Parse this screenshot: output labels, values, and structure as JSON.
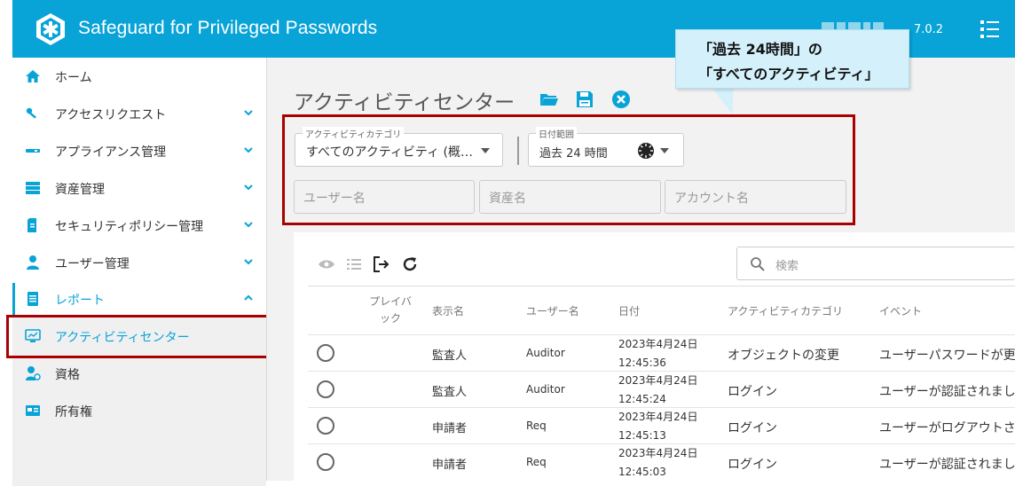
{
  "header": {
    "app_title": "Safeguard for Privileged Passwords",
    "version": "7.0.2"
  },
  "sidebar": {
    "items": [
      {
        "label": "ホーム",
        "icon": "home-icon"
      },
      {
        "label": "アクセスリクエスト",
        "icon": "key-icon"
      },
      {
        "label": "アプライアンス管理",
        "icon": "appliance-icon"
      },
      {
        "label": "資産管理",
        "icon": "server-icon"
      },
      {
        "label": "セキュリティポリシー管理",
        "icon": "policy-icon"
      },
      {
        "label": "ユーザー管理",
        "icon": "user-icon"
      },
      {
        "label": "レポート",
        "icon": "report-icon"
      },
      {
        "label": "アクティビティセンター",
        "icon": "monitor-icon"
      },
      {
        "label": "資格",
        "icon": "entitlement-icon"
      },
      {
        "label": "所有権",
        "icon": "ownership-icon"
      }
    ]
  },
  "page": {
    "title": "アクティビティセンター"
  },
  "filters": {
    "category_legend": "アクティビティカテゴリ",
    "category_value": "すべてのアクティビティ (概…",
    "date_legend": "日付範囲",
    "date_value": "過去 24 時間",
    "user_placeholder": "ユーザー名",
    "asset_placeholder": "資産名",
    "account_placeholder": "アカウント名"
  },
  "callout": {
    "line1": "「過去 24時間」の",
    "line2": "「すべてのアクティビティ」"
  },
  "grid": {
    "search_placeholder": "検索",
    "columns": {
      "playback": "プレイバ\nック",
      "display_name": "表示名",
      "user_name": "ユーザー名",
      "date": "日付",
      "category": "アクティビティカテゴリ",
      "event": "イベント"
    },
    "rows": [
      {
        "display_name": "監査人",
        "user_name": "Auditor",
        "date": "2023年4月24日",
        "time": "12:45:36",
        "category": "オブジェクトの変更",
        "event": "ユーザーパスワードが更"
      },
      {
        "display_name": "監査人",
        "user_name": "Auditor",
        "date": "2023年4月24日",
        "time": "12:45:24",
        "category": "ログイン",
        "event": "ユーザーが認証されまし"
      },
      {
        "display_name": "申請者",
        "user_name": "Req",
        "date": "2023年4月24日",
        "time": "12:45:13",
        "category": "ログイン",
        "event": "ユーザーがログアウトさ"
      },
      {
        "display_name": "申請者",
        "user_name": "Req",
        "date": "2023年4月24日",
        "time": "12:45:03",
        "category": "ログイン",
        "event": "ユーザーが認証されまし"
      }
    ]
  },
  "colors": {
    "accent": "#08a3d7",
    "highlight_border": "#aa0000",
    "callout_bg": "#d4f0fb"
  }
}
